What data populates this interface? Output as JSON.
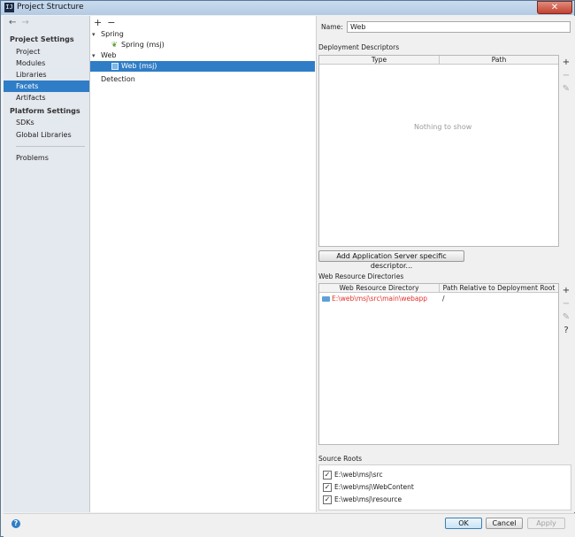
{
  "window": {
    "title": "Project Structure",
    "icon_text": "IJ",
    "close_glyph": "✕"
  },
  "nav": {
    "back": "←",
    "forward": "→"
  },
  "sidebar": {
    "project_settings_heading": "Project Settings",
    "project_settings": [
      "Project",
      "Modules",
      "Libraries",
      "Facets",
      "Artifacts"
    ],
    "platform_settings_heading": "Platform Settings",
    "platform_settings": [
      "SDKs",
      "Global Libraries"
    ],
    "problems": "Problems",
    "selected": "Facets"
  },
  "tree": {
    "add": "+",
    "remove": "−",
    "spring": "Spring",
    "spring_child": "Spring (msj)",
    "web": "Web",
    "web_child": "Web (msj)",
    "detection": "Detection"
  },
  "facet": {
    "name_label": "Name:",
    "name_value": "Web",
    "deployment_descriptors": "Deployment Descriptors",
    "col_type": "Type",
    "col_path": "Path",
    "empty_text": "Nothing to show",
    "add_descriptor_button": "Add Application Server specific descriptor...",
    "web_resource_directories": "Web Resource Directories",
    "col_web_resource_dir": "Web Resource Directory",
    "col_path_relative": "Path Relative to Deployment Root",
    "resource_dir": "E:\\web\\msj\\src\\main\\webapp",
    "resource_rel": "/",
    "source_roots": "Source Roots",
    "roots": [
      "E:\\web\\msj\\src",
      "E:\\web\\msj\\WebContent",
      "E:\\web\\msj\\resource"
    ]
  },
  "toolbar_glyphs": {
    "add": "+",
    "remove": "−",
    "edit": "✎",
    "help": "?"
  },
  "footer": {
    "ok": "OK",
    "cancel": "Cancel",
    "apply": "Apply",
    "help": "?"
  }
}
